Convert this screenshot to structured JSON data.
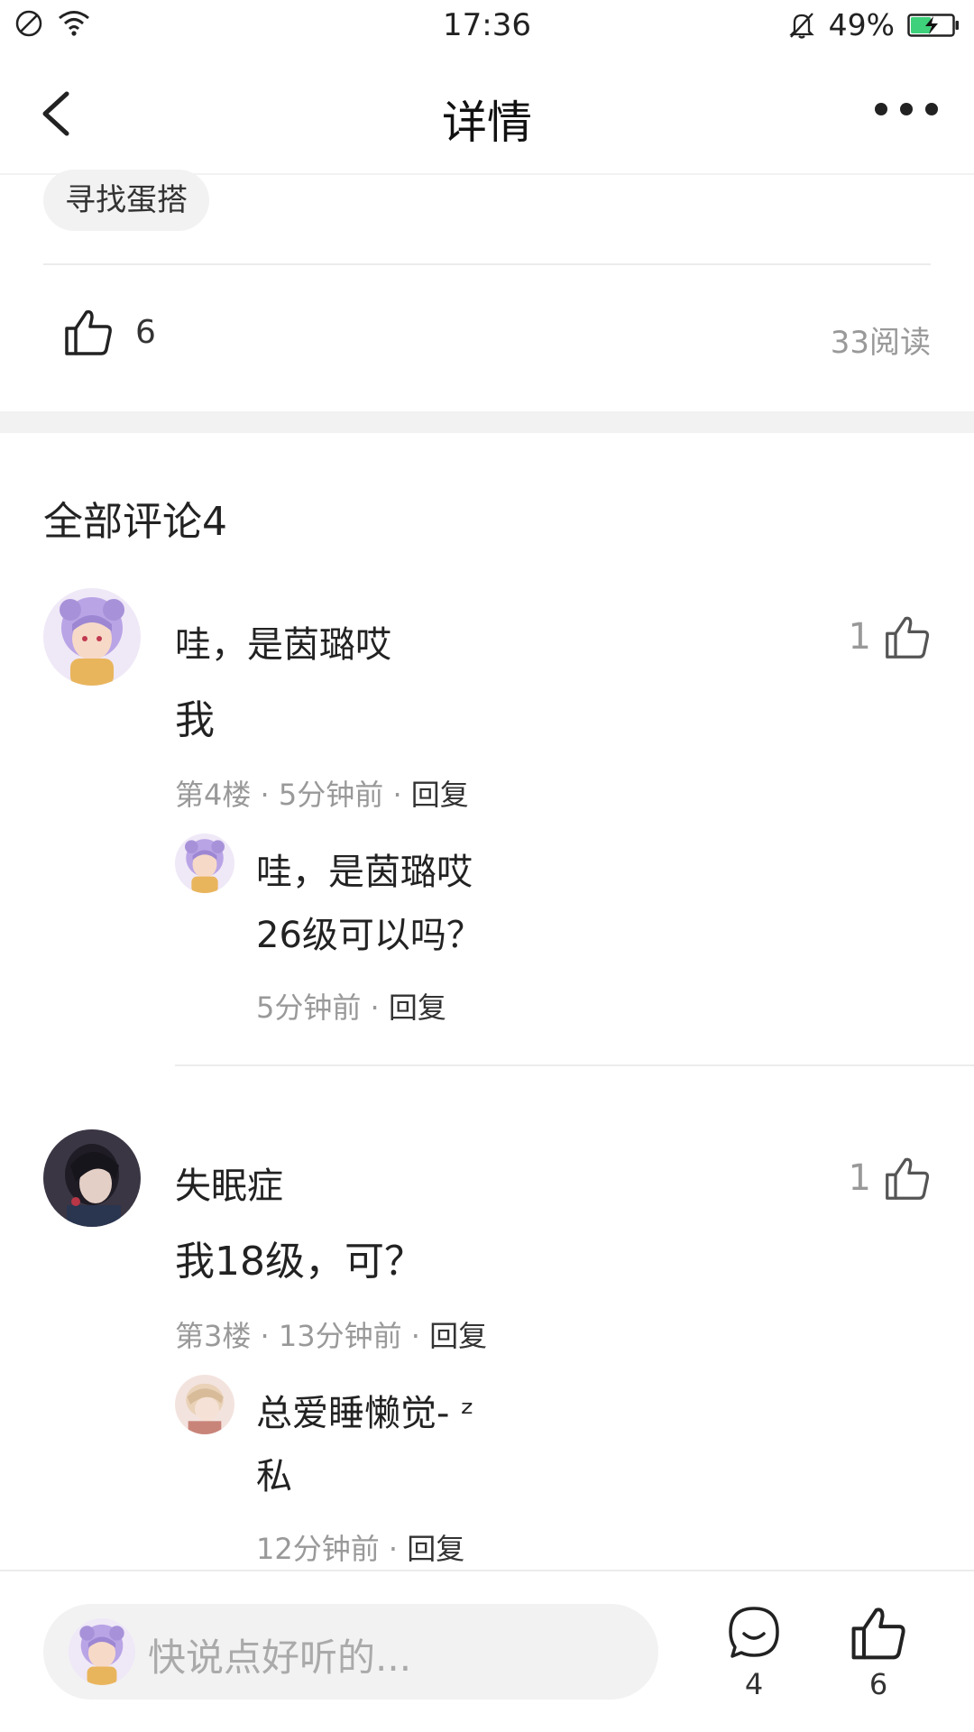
{
  "status_bar": {
    "time": "17:36",
    "battery_percent": "49%",
    "battery_level": 0.49,
    "icons": [
      "no-sim-icon",
      "wifi-icon",
      "mute-bell-icon",
      "battery-charging-icon"
    ]
  },
  "nav": {
    "title": "详情",
    "back_icon": "chevron-left-icon",
    "more_icon": "more-dots-icon"
  },
  "post": {
    "tag": "寻找蛋搭",
    "like_count": "6",
    "read_count": "33阅读"
  },
  "comments_header": "全部评论4",
  "comments": [
    {
      "author": "哇，是茵璐哎",
      "text": "我",
      "floor": "第4楼",
      "time": "5分钟前",
      "reply_label": "回复",
      "like_count": "1",
      "avatar_colors": [
        "#b9a4e6",
        "#f7d9c8"
      ],
      "replies": [
        {
          "author": "哇，是茵璐哎",
          "text": "26级可以吗？",
          "time": "5分钟前",
          "reply_label": "回复"
        }
      ]
    },
    {
      "author": "失眠症",
      "text": "我18级，可？",
      "floor": "第3楼",
      "time": "13分钟前",
      "reply_label": "回复",
      "like_count": "1",
      "avatar_colors": [
        "#2d2a36",
        "#7b6d74"
      ],
      "replies": [
        {
          "author": "总爱睡懒觉- ᶻ",
          "text": "私",
          "time": "12分钟前",
          "reply_label": "回复"
        }
      ]
    }
  ],
  "bottom_bar": {
    "placeholder": "快说点好听的...",
    "comment_count": "4",
    "like_count": "6"
  },
  "colors": {
    "text_primary": "#222222",
    "text_secondary": "#999999",
    "background": "#ffffff",
    "separator": "#f2f2f2",
    "battery_green": "#3ed07a"
  }
}
